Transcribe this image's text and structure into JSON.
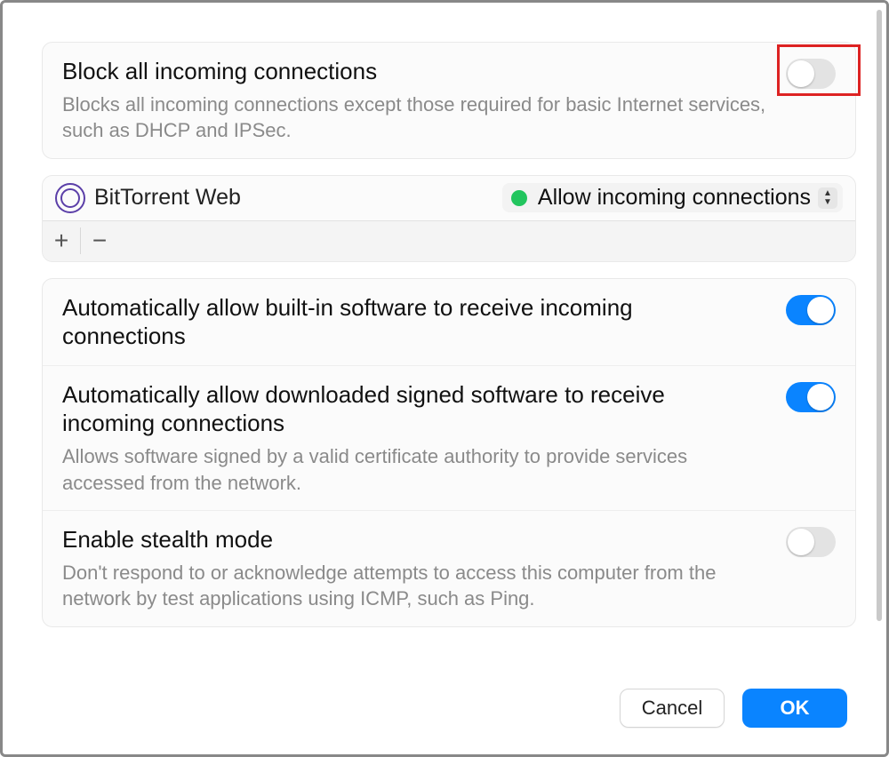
{
  "settings": {
    "block_all": {
      "title": "Block all incoming connections",
      "subtitle": "Blocks all incoming connections except those required for basic Internet services, such as DHCP and IPSec.",
      "enabled": false,
      "highlighted": true
    },
    "apps": [
      {
        "name": "BitTorrent Web",
        "status_color": "#22c55e",
        "policy_label": "Allow incoming connections"
      }
    ],
    "app_toolbar": {
      "add": "+",
      "remove": "−"
    },
    "auto_builtin": {
      "title": "Automatically allow built-in software to receive incoming connections",
      "enabled": true
    },
    "auto_signed": {
      "title": "Automatically allow downloaded signed software to receive incoming connections",
      "subtitle": "Allows software signed by a valid certificate authority to provide services accessed from the network.",
      "enabled": true
    },
    "stealth": {
      "title": "Enable stealth mode",
      "subtitle": "Don't respond to or acknowledge attempts to access this computer from the network by test applications using ICMP, such as Ping.",
      "enabled": false
    }
  },
  "footer": {
    "cancel": "Cancel",
    "ok": "OK"
  }
}
